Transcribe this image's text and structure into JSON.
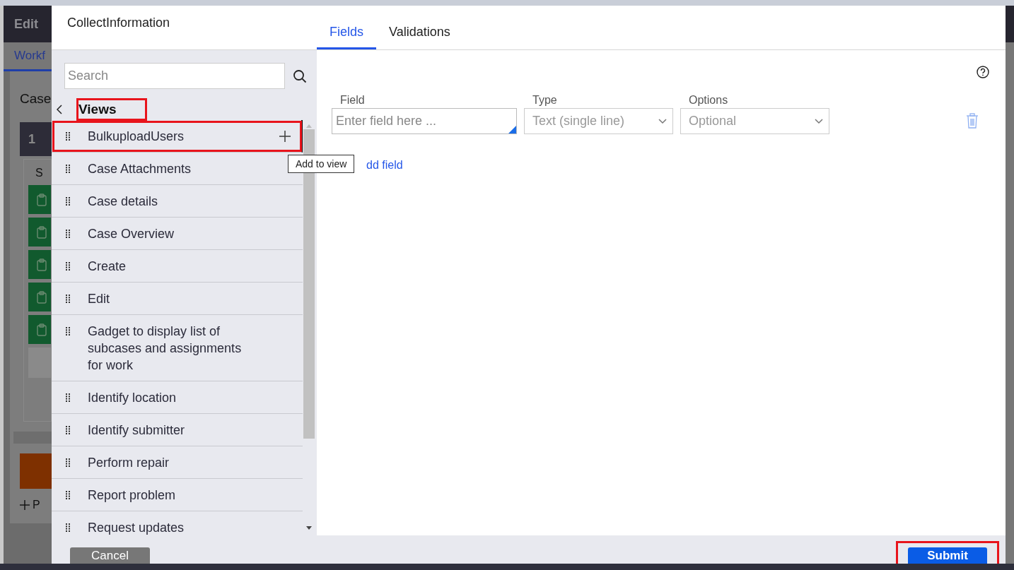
{
  "background": {
    "header_title": "Edit",
    "tab": "Workf",
    "heading": "Case",
    "card_label": "1",
    "column_label": "S",
    "add_label": "P"
  },
  "dialog": {
    "title": "CollectInformation",
    "tabs": [
      {
        "label": "Fields",
        "selected": true
      },
      {
        "label": "Validations",
        "selected": false
      }
    ],
    "search": {
      "placeholder": "Search"
    },
    "views_header": {
      "label": "Views",
      "annotated": true
    },
    "views": [
      {
        "label": "BulkuploadUsers",
        "hovered": true,
        "annotated": true
      },
      {
        "label": "Case Attachments",
        "hovered": false,
        "annotated": false
      },
      {
        "label": "Case details",
        "hovered": false,
        "annotated": false
      },
      {
        "label": "Case Overview",
        "hovered": false,
        "annotated": false
      },
      {
        "label": "Create",
        "hovered": false,
        "annotated": false
      },
      {
        "label": "Edit",
        "hovered": false,
        "annotated": false
      },
      {
        "label": "Gadget to display list of subcases and assignments for work",
        "hovered": false,
        "annotated": false
      },
      {
        "label": "Identify location",
        "hovered": false,
        "annotated": false
      },
      {
        "label": "Identify submitter",
        "hovered": false,
        "annotated": false
      },
      {
        "label": "Perform repair",
        "hovered": false,
        "annotated": false
      },
      {
        "label": "Report problem",
        "hovered": false,
        "annotated": false
      },
      {
        "label": "Request updates",
        "hovered": false,
        "annotated": false
      }
    ],
    "tooltip": "Add to view",
    "fields": {
      "columns": [
        "Field",
        "Type",
        "Options"
      ],
      "rows": [
        {
          "field_placeholder": "Enter field here ...",
          "type": "Text (single line)",
          "option": "Optional"
        }
      ],
      "add_link": "dd field"
    },
    "buttons": {
      "cancel": {
        "label": "Cancel"
      },
      "submit": {
        "label": "Submit",
        "annotated": true
      }
    }
  }
}
